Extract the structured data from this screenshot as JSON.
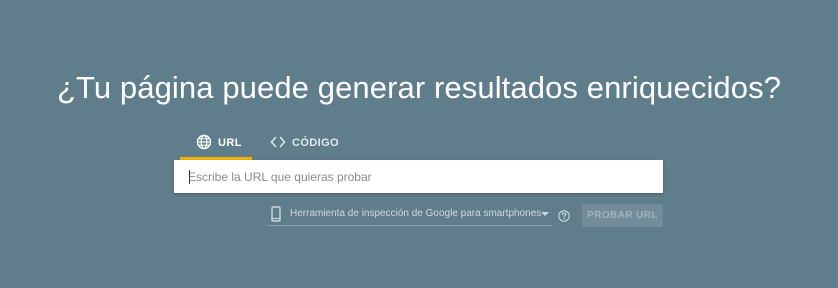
{
  "page": {
    "heading": "¿Tu página puede generar resultados enriquecidos?"
  },
  "tabs": [
    {
      "label": "URL",
      "icon": "globe-icon",
      "active": true
    },
    {
      "label": "CÓDIGO",
      "icon": "code-icon",
      "active": false
    }
  ],
  "url_input": {
    "placeholder": "Escribe la URL que quieras probar",
    "value": ""
  },
  "device_select": {
    "icon": "smartphone-icon",
    "selected": "Herramienta de inspección de Google para smartphones"
  },
  "help": {
    "icon": "help-circle-icon"
  },
  "test_button": {
    "label": "PROBAR URL",
    "enabled": false
  },
  "colors": {
    "background": "#607d8b",
    "active_tab_indicator": "#f4b400",
    "button_disabled_bg": "#728d99"
  }
}
